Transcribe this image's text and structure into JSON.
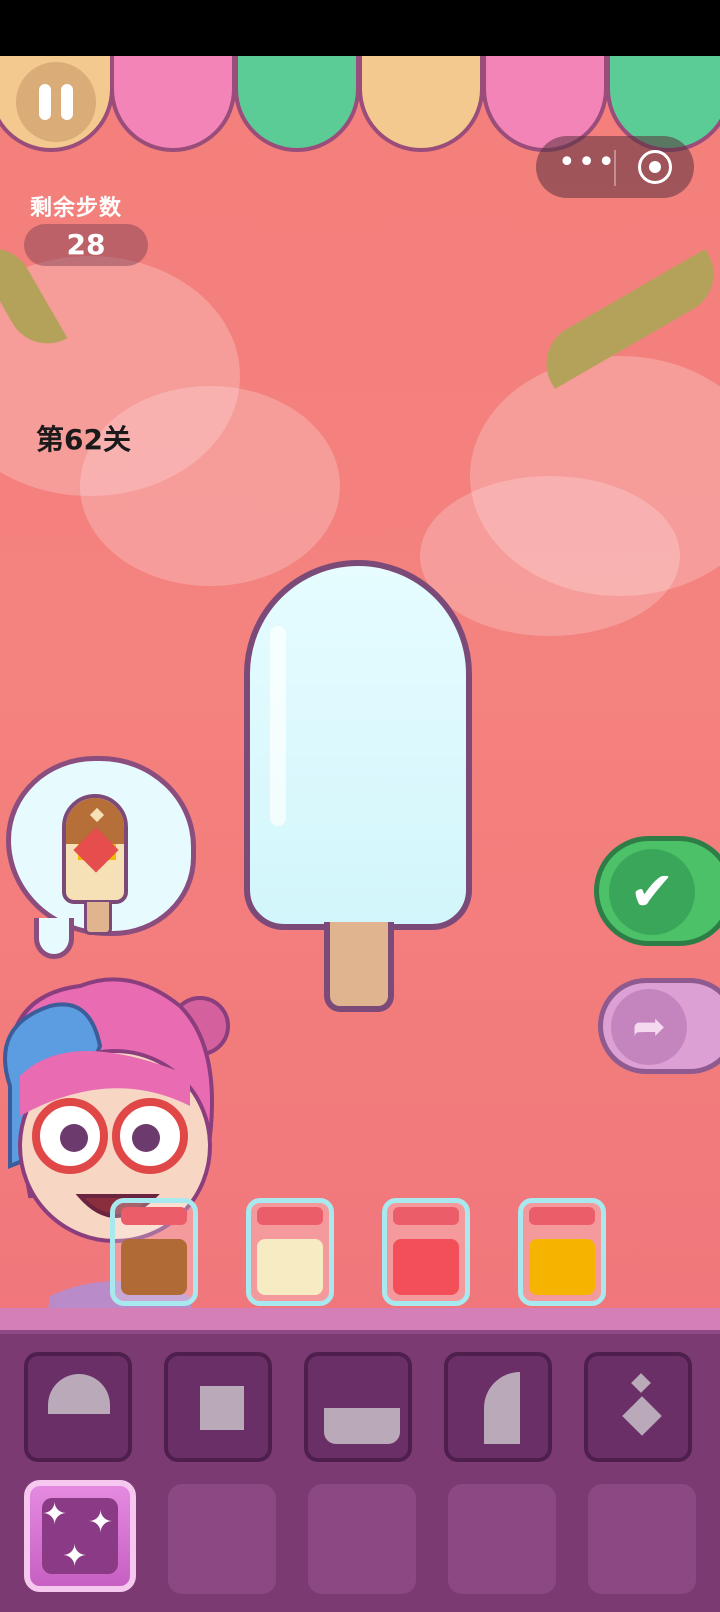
{
  "hud": {
    "steps_label": "剩余步数",
    "steps_value": "28",
    "level_label": "第62关"
  },
  "capsule": {
    "more_icon": "more-dots-icon",
    "close_icon": "target-circle-icon",
    "dots": "•••"
  },
  "buttons": {
    "confirm_glyph": "✔",
    "redo_glyph": "➦"
  },
  "jars": [
    {
      "name": "chocolate",
      "color": "#b06a36"
    },
    {
      "name": "vanilla",
      "color": "#f7ebc3"
    },
    {
      "name": "strawberry",
      "color": "#f24f58"
    },
    {
      "name": "mango",
      "color": "#f6b400"
    }
  ],
  "shape_tools": [
    "dome-shape-icon",
    "square-shape-icon",
    "bowl-shape-icon",
    "half-oval-shape-icon",
    "diamonds-shape-icon"
  ],
  "colors": {
    "awning": [
      "#f3c98f",
      "#f284b8",
      "#5ccc96",
      "#f3c98f",
      "#f284b8",
      "#5ccc96"
    ],
    "background": "#f47f7c",
    "confirm": "#4cc168"
  }
}
